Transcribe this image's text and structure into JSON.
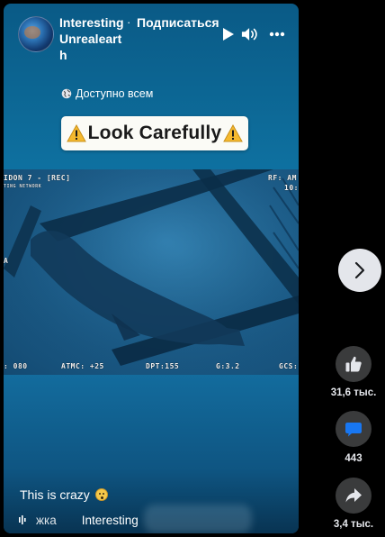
{
  "video": {
    "channel_name": "Interesting Unrealearth",
    "separator": "·",
    "subscribe_label": "Подписаться",
    "audience_label": "Доступно всем",
    "caption_text": "Look Carefully",
    "osd": {
      "top_left": "IDON 7 - [REC]",
      "top_left_sub": "TING NETWORK",
      "top_right": "RF: AM",
      "top_right_sub": "10:",
      "left_mark": "A",
      "bottom_1": ": 080",
      "bottom_2": "ATMC: +25",
      "bottom_3": "DPT:155",
      "bottom_4": "G:3.2",
      "bottom_5": "GCS:"
    },
    "post_text": "This is crazy",
    "audio_label": "жка",
    "channel_mention": "Interesting"
  },
  "side": {
    "likes_count": "31,6 тыс.",
    "comments_count": "443",
    "shares_count": "3,4 тыс."
  },
  "icons": {
    "play": "play-icon",
    "volume": "volume-icon",
    "more": "more-icon",
    "globe": "globe-icon",
    "warning": "warning-icon",
    "next": "chevron-right-icon",
    "like": "thumbs-up-icon",
    "comment": "comment-icon",
    "share": "share-icon",
    "music": "music-icon"
  },
  "colors": {
    "accent_blue": "#1877f2",
    "panel_bg": "#3a3b3c",
    "next_bg": "#e4e6eb"
  }
}
